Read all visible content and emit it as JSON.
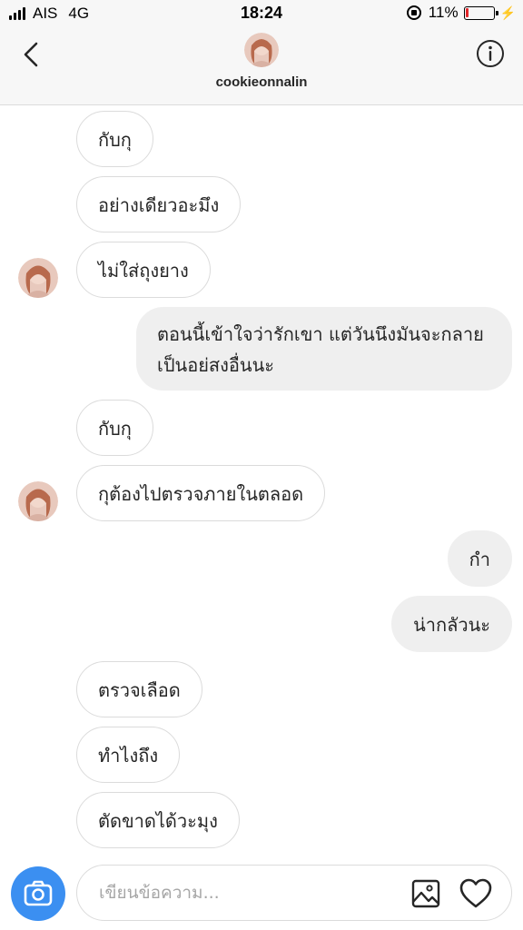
{
  "status_bar": {
    "carrier": "AIS",
    "network": "4G",
    "time": "18:24",
    "battery_percent": "11%",
    "battery_level": 0.11,
    "battery_color": "#e3262a"
  },
  "header": {
    "username": "cookieonnalin",
    "back_icon": "chevron-left-icon",
    "info_icon": "info-icon"
  },
  "messages": [
    {
      "direction": "in",
      "text": "กับกุ"
    },
    {
      "direction": "in",
      "text": "อย่างเดียวอะมึง"
    },
    {
      "direction": "in",
      "text": "ไม่ใส่ถุงยาง",
      "avatar": true
    },
    {
      "direction": "out",
      "text": "ตอนนี้เข้าใจว่ารักเขา แต่วันนึงมันจะกลายเป็นอย่สงอื่นนะ"
    },
    {
      "direction": "in",
      "text": "กับกุ"
    },
    {
      "direction": "in",
      "text": "กุต้องไปตรวจภายในตลอด",
      "avatar": true
    },
    {
      "direction": "out",
      "text": "กำ"
    },
    {
      "direction": "out",
      "text": "น่ากลัวนะ"
    },
    {
      "direction": "in",
      "text": "ตรวจเลือด"
    },
    {
      "direction": "in",
      "text": "ทำไงถึง"
    },
    {
      "direction": "in",
      "text": "ตัดขาดได้วะมุง"
    }
  ],
  "composer": {
    "placeholder": "เขียนข้อความ...",
    "camera_icon": "camera-icon",
    "gallery_icon": "gallery-icon",
    "heart_icon": "heart-icon",
    "accent_color": "#3b8ff1"
  }
}
